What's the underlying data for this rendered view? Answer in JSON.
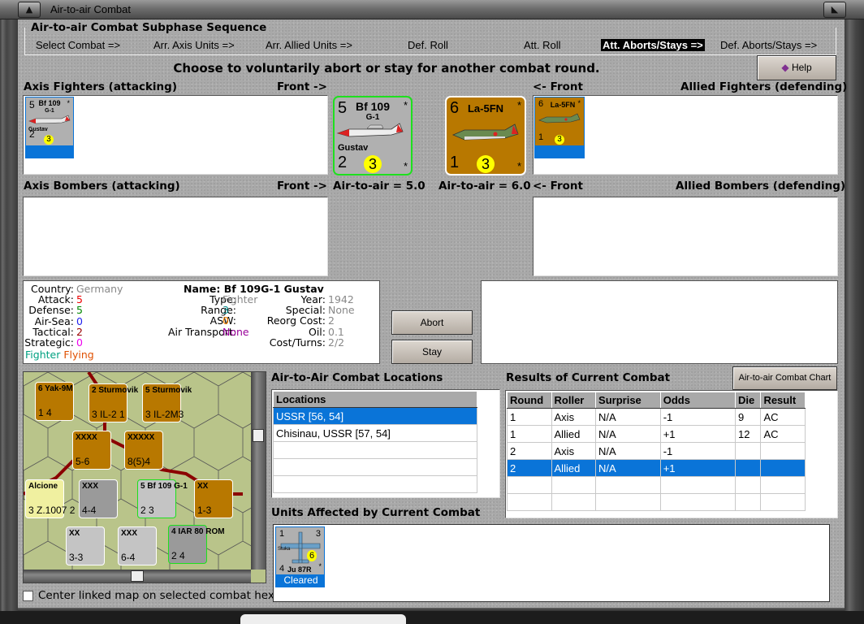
{
  "window": {
    "title": "Air-to-air Combat"
  },
  "sequence": {
    "title": "Air-to-air Combat Subphase Sequence",
    "steps": [
      "Select Combat =>",
      "Arr. Axis Units =>",
      "Arr. Allied Units =>",
      "Def. Roll",
      "Att. Roll",
      "Att. Aborts/Stays =>",
      "Def. Aborts/Stays =>"
    ],
    "active_index": 5
  },
  "instruction": "Choose to voluntarily abort or stay for another combat round.",
  "help_label": "Help",
  "labels": {
    "axis_fighters": "Axis Fighters (attacking)",
    "front_right": "Front ->",
    "front_left": "<- Front",
    "allied_fighters": "Allied Fighters (defending)",
    "axis_bombers": "Axis Bombers (attacking)",
    "allied_bombers": "Allied Bombers (defending)",
    "axis_air": "Air-to-air = 5.0",
    "allied_air": "Air-to-air = 6.0"
  },
  "axis_counter": {
    "attack": "5",
    "name": "Bf 109",
    "variant": "G-1",
    "nickname": "Gustav",
    "defense": "2",
    "range": "3",
    "star": "*"
  },
  "allied_counter": {
    "attack": "6",
    "name": "La-5FN",
    "defense": "1",
    "range": "3",
    "star": "*"
  },
  "info": {
    "country_label": "Country:",
    "country": "Germany",
    "attack_label": "Attack:",
    "attack": "5",
    "defense_label": "Defense:",
    "defense": "5",
    "airsea_label": "Air-Sea:",
    "airsea": "0",
    "tactical_label": "Tactical:",
    "tactical": "2",
    "strategic_label": "Strategic:",
    "strategic": "0",
    "class1": "Fighter",
    "class2": "Flying",
    "name": "Name: Bf 109G-1 Gustav",
    "type_label": "Type:",
    "type": "Fighter",
    "range_label": "Range:",
    "range": "3",
    "asw_label": "ASW:",
    "asw": "0",
    "transport_label": "Air Transport:",
    "transport": "None",
    "year_label": "Year:",
    "year": "1942",
    "special_label": "Special:",
    "special": "None",
    "reorg_label": "Reorg Cost:",
    "reorg": "2",
    "oil_label": "Oil:",
    "oil": "0.1",
    "cost_label": "Cost/Turns:",
    "cost": "2/2"
  },
  "buttons": {
    "abort": "Abort",
    "stay": "Stay",
    "chart": "Air-to-air Combat Chart"
  },
  "locations": {
    "title": "Air-to-Air Combat Locations",
    "header": "Locations",
    "rows": [
      "USSR [56, 54]",
      "Chisinau, USSR [57, 54]",
      "",
      "",
      ""
    ],
    "selected": 0
  },
  "results": {
    "title": "Results of Current Combat",
    "headers": [
      "Round",
      "Roller",
      "Surprise",
      "Odds",
      "Die",
      "Result"
    ],
    "rows": [
      [
        "1",
        "Axis",
        "N/A",
        "-1",
        "9",
        "AC"
      ],
      [
        "1",
        "Allied",
        "N/A",
        "+1",
        "12",
        "AC"
      ],
      [
        "2",
        "Axis",
        "N/A",
        "-1",
        "",
        ""
      ],
      [
        "2",
        "Allied",
        "N/A",
        "+1",
        "",
        ""
      ],
      [
        "",
        "",
        "",
        "",
        "",
        ""
      ],
      [
        "",
        "",
        "",
        "",
        "",
        ""
      ]
    ],
    "selected": 3
  },
  "affected": {
    "title": "Units Affected by Current Combat",
    "unit": {
      "tl": "1",
      "tr": "3",
      "nick": "Stuka",
      "range": "6",
      "bl": "4",
      "name": "Ju 87R",
      "star": "*",
      "status": "Cleared"
    }
  },
  "map": {
    "checkbox_label": "Center linked map on selected combat hex",
    "checked": false,
    "counters": [
      {
        "top": "6 Yak-9M",
        "bot": "1  4",
        "c": "brown"
      },
      {
        "top": "2 Sturmovik",
        "bot": "3 IL-2 1",
        "c": "brown"
      },
      {
        "top": "5 Sturmovik",
        "bot": "3 IL-2M3",
        "c": "brown"
      },
      {
        "top": "XXXX",
        "bot": "5-6",
        "c": "brown"
      },
      {
        "top": "XXXXX",
        "bot": "8(5)4",
        "c": "brown"
      },
      {
        "top": "Alcione",
        "bot": "3 Z.1007 2",
        "c": "yel"
      },
      {
        "top": "XXX",
        "bot": "4-4",
        "c": "gray"
      },
      {
        "top": "5 Bf 109 G-1",
        "bot": "2  3",
        "c": "lgray"
      },
      {
        "top": "XX",
        "bot": "1-3",
        "c": "brown"
      },
      {
        "top": "XX",
        "bot": "3-3",
        "c": "lgray"
      },
      {
        "top": "XXX",
        "bot": "6-4",
        "c": "lgray"
      },
      {
        "top": "4 IAR 80 ROM",
        "bot": "2  4",
        "c": "gray"
      }
    ]
  }
}
